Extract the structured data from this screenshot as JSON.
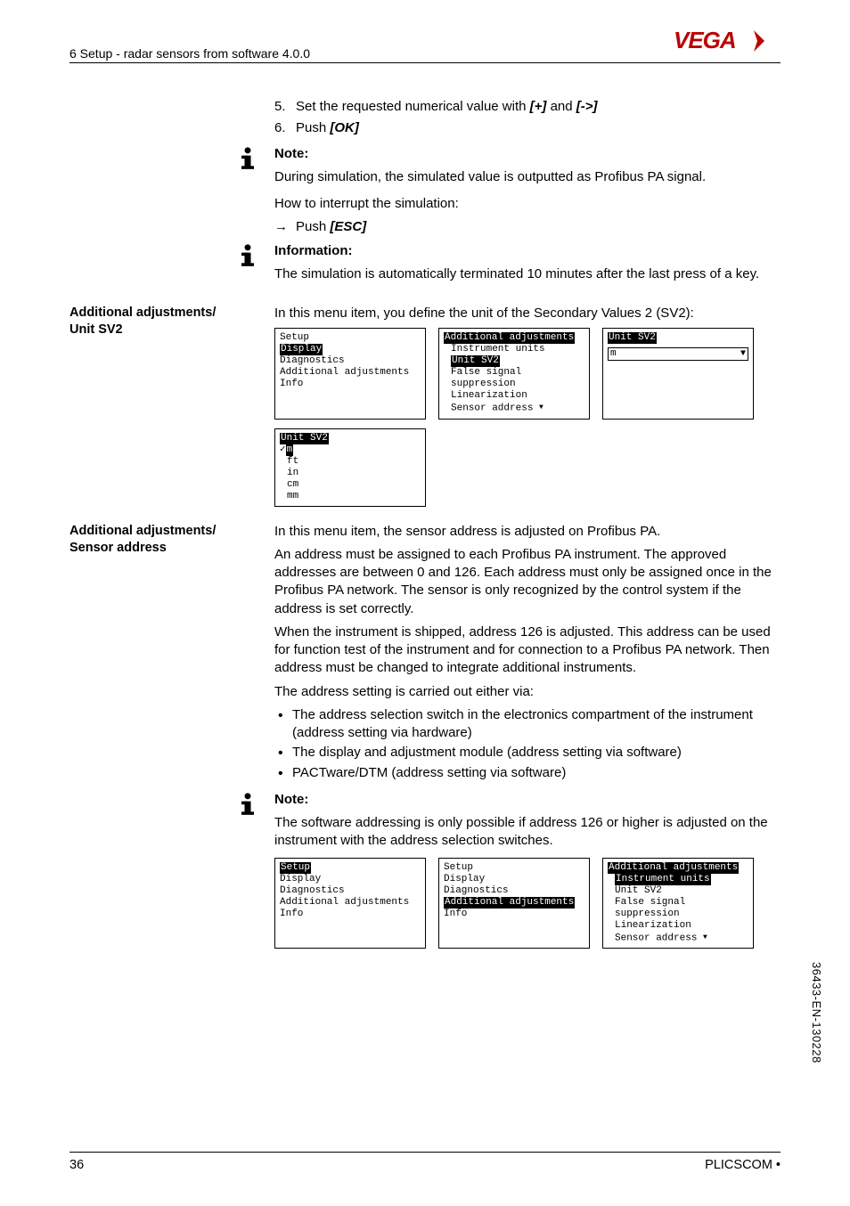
{
  "header": {
    "section": "6 Setup - radar sensors from software 4.0.0",
    "logo": "VEGA"
  },
  "step5": {
    "num": "5.",
    "text_a": "Set the requested numerical value with ",
    "key1": "[+]",
    "and": " and ",
    "key2": "[->]"
  },
  "step6": {
    "num": "6.",
    "text_a": "Push ",
    "key": "[OK]"
  },
  "note1": {
    "title": "Note:",
    "body": "During simulation, the simulated value is outputted as Profibus PA signal."
  },
  "interrupt": {
    "lead": "How to interrupt the simulation:",
    "arrow": "→",
    "push": "Push ",
    "key": "[ESC]"
  },
  "info1": {
    "title": "Information:",
    "body": "The simulation is automatically terminated 10 minutes after the last press of a key."
  },
  "unitSV2": {
    "side": "Additional adjustments/Unit SV2",
    "intro": "In this menu item, you define the unit of the Secondary Values 2 (SV2):",
    "screen1": {
      "l1": "Setup",
      "l2": "Display",
      "l3": "Diagnostics",
      "l4": "Additional adjustments",
      "l5": "Info"
    },
    "screen2": {
      "l1": "Additional adjustments",
      "l2": "Instrument units",
      "l3": "Unit SV2",
      "l4": "False signal suppression",
      "l5": "Linearization",
      "l6": "Sensor address"
    },
    "screen3": {
      "title": "Unit SV2",
      "value": "m"
    },
    "screen4": {
      "title": "Unit SV2",
      "o1": "m",
      "o2": "ft",
      "o3": "in",
      "o4": "cm",
      "o5": "mm"
    }
  },
  "sensorAddr": {
    "side": "Additional adjustments/Sensor address",
    "p1": "In this menu item, the sensor address is adjusted on Profibus PA.",
    "p2": "An address must be assigned to each Profibus PA instrument. The approved addresses are between 0 and 126. Each address must only be assigned once in the Profibus PA network. The sensor is only recognized by the control system if the address is set correctly.",
    "p3": "When the instrument is shipped, address 126 is adjusted. This address can be used for function test of the instrument and for connection to a Profibus PA network. Then address must be changed to integrate additional instruments.",
    "p4": "The address setting is carried out either via:",
    "b1": "The address selection switch in the electronics compartment of the instrument (address setting via hardware)",
    "b2": "The display and adjustment module (address setting via software)",
    "b3": "PACTware/DTM (address setting via software)"
  },
  "note2": {
    "title": "Note:",
    "body": "The software addressing is only possible if address 126 or higher is adjusted on the instrument with the address selection switches."
  },
  "screensBottom": {
    "s1": {
      "l1": "Setup",
      "l2": "Display",
      "l3": "Diagnostics",
      "l4": "Additional adjustments",
      "l5": "Info"
    },
    "s2": {
      "l1": "Setup",
      "l2": "Display",
      "l3": "Diagnostics",
      "l4": "Additional adjustments",
      "l5": "Info"
    },
    "s3": {
      "l1": "Additional adjustments",
      "l2": "Instrument units",
      "l3": "Unit SV2",
      "l4": "False signal suppression",
      "l5": "Linearization",
      "l6": "Sensor address"
    }
  },
  "footer": {
    "page": "36",
    "product": "PLICSCOM •",
    "docid": "36433-EN-130228"
  }
}
